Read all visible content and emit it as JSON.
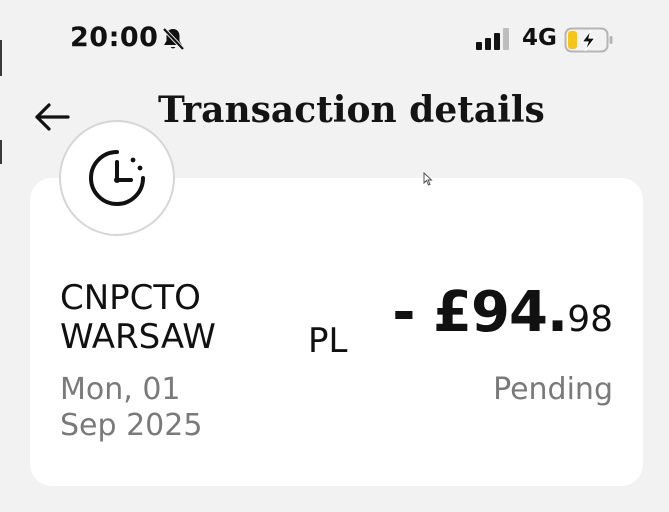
{
  "status_bar": {
    "time": "20:00",
    "network": "4G",
    "icons": [
      "bell-muted-icon",
      "signal-icon",
      "battery-charging-icon"
    ]
  },
  "header": {
    "back_icon": "arrow-left-icon",
    "title": "Transaction details"
  },
  "transaction": {
    "icon": "clock-pending-icon",
    "merchant_line1": "CNPCTO",
    "merchant_line2": "WARSAW",
    "country": "PL",
    "amount_main": "- £94.",
    "amount_pence": "98",
    "date_line1": "Mon, 01",
    "date_line2": "Sep 2025",
    "status": "Pending"
  },
  "colors": {
    "background": "#f2f2f2",
    "card": "#ffffff",
    "text_primary": "#111111",
    "text_secondary": "#7a7a7a",
    "battery_fill": "#f5c518"
  }
}
